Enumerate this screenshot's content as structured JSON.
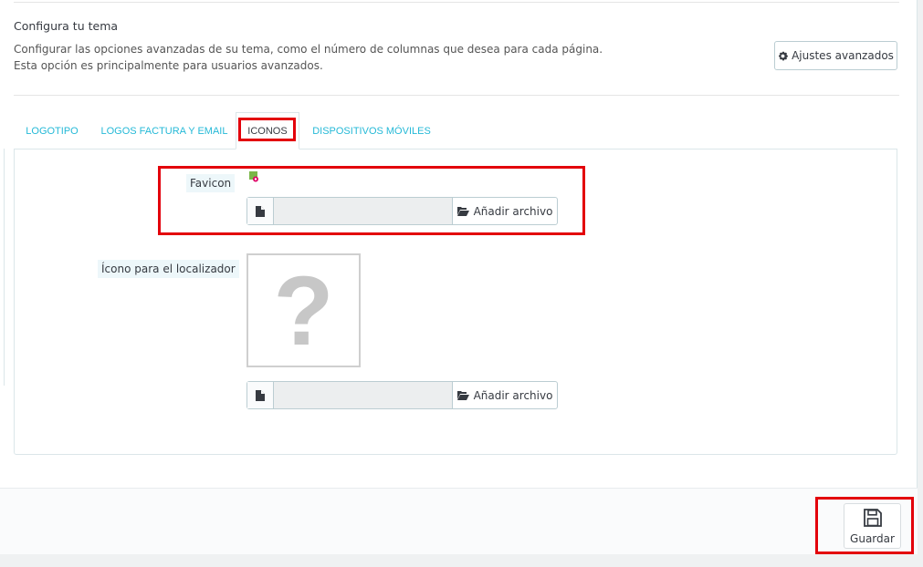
{
  "section": {
    "title": "Configura tu tema",
    "description": "Configurar las opciones avanzadas de su tema, como el número de columnas que desea para cada página. Esta opción es principalmente para usuarios avanzados."
  },
  "advanced_button": {
    "label": "Ajustes avanzados",
    "icon": "gear-icon"
  },
  "tabs": [
    {
      "label": "LOGOTIPO",
      "active": false
    },
    {
      "label": "LOGOS FACTURA Y EMAIL",
      "active": false
    },
    {
      "label": "ICONOS",
      "active": true
    },
    {
      "label": "DISPOSITIVOS MÓVILES",
      "active": false
    }
  ],
  "fields": {
    "favicon": {
      "label": "Favicon",
      "button": "Añadir archivo",
      "file_value": ""
    },
    "locator": {
      "label": "Ícono para el localizador",
      "button": "Añadir archivo",
      "file_value": "",
      "preview": "?"
    }
  },
  "save": {
    "label": "Guardar",
    "icon": "floppy-disk-icon"
  },
  "colors": {
    "accent": "#25b9d7",
    "highlight": "#e3000b",
    "border": "#bbcdd2"
  }
}
